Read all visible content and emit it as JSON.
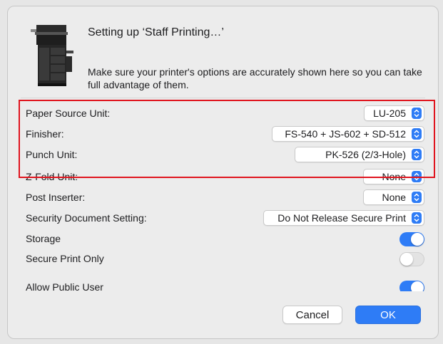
{
  "dialog": {
    "title": "Setting up ‘Staff Printing…’",
    "subtitle": "Make sure your printer's options are accurately shown here so you can take full advantage of them."
  },
  "options": [
    {
      "label": "Paper Source Unit:",
      "type": "popup",
      "value": "LU-205"
    },
    {
      "label": "Finisher:",
      "type": "popup",
      "value": "FS-540 + JS-602 + SD-512"
    },
    {
      "label": "Punch Unit:",
      "type": "popup",
      "value": "PK-526 (2/3-Hole)"
    },
    {
      "label": "Z-Fold Unit:",
      "type": "popup",
      "value": "None"
    },
    {
      "label": "Post Inserter:",
      "type": "popup",
      "value": "None"
    },
    {
      "label": "Security Document Setting:",
      "type": "popup",
      "value": "Do Not Release Secure Print"
    },
    {
      "label": "Storage",
      "type": "toggle",
      "on": true
    },
    {
      "label": "Secure Print Only",
      "type": "toggle",
      "on": false
    },
    {
      "label": "Allow Public User",
      "type": "toggle",
      "on": true
    }
  ],
  "buttons": {
    "cancel": "Cancel",
    "ok": "OK"
  },
  "colors": {
    "accent": "#2e7cf6",
    "highlight": "#e0141e"
  }
}
